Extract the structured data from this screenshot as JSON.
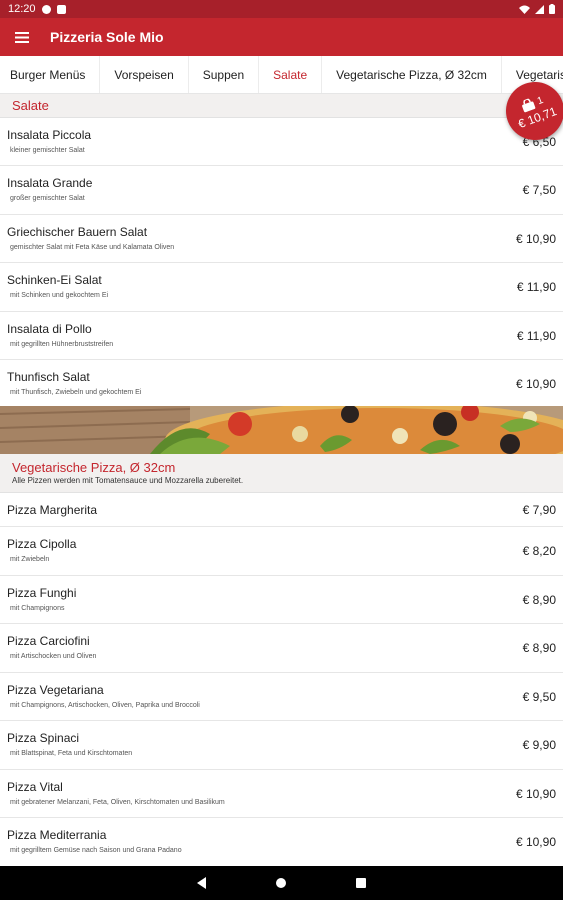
{
  "status_bar": {
    "time": "12:20"
  },
  "app_bar": {
    "title": "Pizzeria Sole Mio"
  },
  "tabs": [
    {
      "label": "Burger Menüs"
    },
    {
      "label": "Vorspeisen"
    },
    {
      "label": "Suppen"
    },
    {
      "label": "Salate",
      "active": true
    },
    {
      "label": "Vegetarische Pizza, Ø 32cm"
    },
    {
      "label": "Vegetarisch"
    }
  ],
  "cart": {
    "count": "1",
    "total": "€ 10,71"
  },
  "salate": {
    "title": "Salate",
    "items": [
      {
        "name": "Insalata Piccola",
        "desc": "kleiner gemischter Salat",
        "price": "€ 6,50"
      },
      {
        "name": "Insalata Grande",
        "desc": "großer gemischter Salat",
        "price": "€ 7,50"
      },
      {
        "name": "Griechischer Bauern Salat",
        "desc": "gemischter Salat mit Feta Käse und Kalamata Oliven",
        "price": "€ 10,90"
      },
      {
        "name": "Schinken-Ei Salat",
        "desc": "mit Schinken und gekochtem Ei",
        "price": "€ 11,90"
      },
      {
        "name": "Insalata di Pollo",
        "desc": "mit gegrillten Hühnerbruststreifen",
        "price": "€ 11,90"
      },
      {
        "name": "Thunfisch Salat",
        "desc": "mit Thunfisch, Zwiebeln und gekochtem Ei",
        "price": "€ 10,90"
      }
    ]
  },
  "vegetarische_pizza": {
    "title": "Vegetarische Pizza, Ø 32cm",
    "description": "Alle Pizzen werden mit Tomatensauce und Mozzarella zubereitet.",
    "items": [
      {
        "name": "Pizza Margherita",
        "desc": "",
        "price": "€ 7,90"
      },
      {
        "name": "Pizza Cipolla",
        "desc": "mit Zwiebeln",
        "price": "€ 8,20"
      },
      {
        "name": "Pizza Funghi",
        "desc": "mit Champignons",
        "price": "€ 8,90"
      },
      {
        "name": "Pizza Carciofini",
        "desc": "mit Artischocken und Oliven",
        "price": "€ 8,90"
      },
      {
        "name": "Pizza Vegetariana",
        "desc": "mit Champignons, Artischocken, Oliven, Paprika und Broccoli",
        "price": "€ 9,50"
      },
      {
        "name": "Pizza Spinaci",
        "desc": "mit Blattspinat, Feta und Kirschtomaten",
        "price": "€ 9,90"
      },
      {
        "name": "Pizza Vital",
        "desc": "mit gebratener Melanzani, Feta, Oliven, Kirschtomaten und Basilikum",
        "price": "€ 10,90"
      },
      {
        "name": "Pizza Mediterrania",
        "desc": "mit gegrilltem Gemüse nach Saison und Grana Padano",
        "price": "€ 10,90"
      }
    ]
  },
  "colors": {
    "primary": "#c4262e",
    "status_bar": "#a7202a"
  },
  "icons": {
    "menu": "hamburger-icon",
    "cart": "shopping-bag-icon",
    "back": "back-icon",
    "home": "home-icon",
    "recents": "recents-icon"
  }
}
